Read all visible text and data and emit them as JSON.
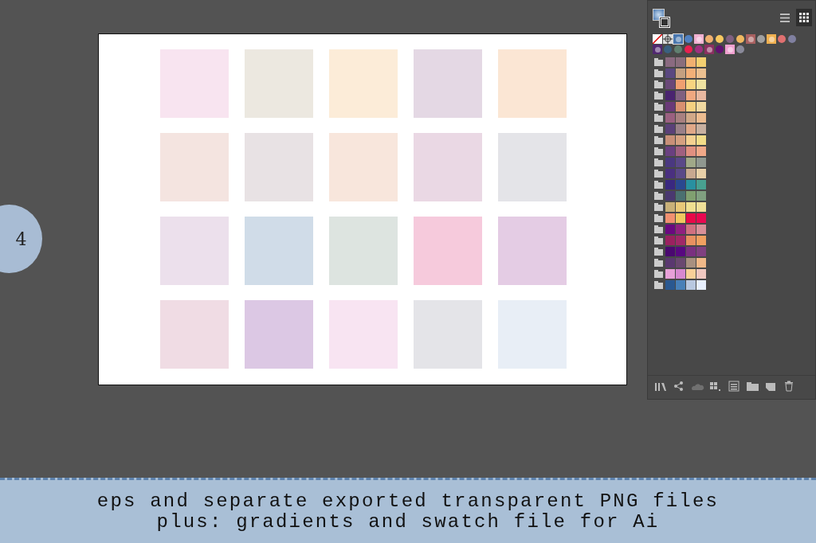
{
  "step_badge": {
    "label": "4"
  },
  "artboard": {
    "tiles": [
      {
        "color": "#f8e4f0"
      },
      {
        "color": "#ece8e0"
      },
      {
        "color": "#fcecd8"
      },
      {
        "color": "#e4d8e4"
      },
      {
        "color": "#fbe6d4"
      },
      {
        "color": "#f4e4e0"
      },
      {
        "color": "#e8e2e4"
      },
      {
        "color": "#f8e6dc"
      },
      {
        "color": "#ead8e4"
      },
      {
        "color": "#e4e4e8"
      },
      {
        "color": "#ece0ec"
      },
      {
        "color": "#d0dce8"
      },
      {
        "color": "#dde4e0"
      },
      {
        "color": "#f6cadc"
      },
      {
        "color": "#e4cce4"
      },
      {
        "color": "#f0dce4"
      },
      {
        "color": "#dcc8e4"
      },
      {
        "color": "#f8e4f2"
      },
      {
        "color": "#e4e4e8"
      },
      {
        "color": "#e8eef6"
      }
    ]
  },
  "swatches_panel": {
    "views": [
      {
        "kind": "list",
        "selected": false
      },
      {
        "kind": "grid",
        "selected": true
      }
    ],
    "gradient_swatches": [
      {
        "kind": "none",
        "selected": false
      },
      {
        "kind": "registration",
        "selected": false
      },
      {
        "kind": "square",
        "color": "#4a78b0",
        "selected": true
      },
      {
        "kind": "circle",
        "color": "#5080c0",
        "selected": false
      },
      {
        "kind": "square",
        "color": "#f0b0d0",
        "selected": false
      },
      {
        "kind": "circle",
        "color": "#f0b070",
        "selected": false
      },
      {
        "kind": "circle",
        "color": "#f8c860",
        "selected": false
      },
      {
        "kind": "circle",
        "color": "#806080",
        "selected": false
      },
      {
        "kind": "circle",
        "color": "#f0b860",
        "selected": false
      },
      {
        "kind": "square",
        "color": "#a86060",
        "selected": false
      },
      {
        "kind": "circle",
        "color": "#a0a0a0",
        "selected": false
      },
      {
        "kind": "square",
        "color": "#f0b050",
        "selected": false
      },
      {
        "kind": "circle",
        "color": "#e07070",
        "selected": false
      },
      {
        "kind": "circle",
        "color": "#8080a0",
        "selected": false
      },
      {
        "kind": "square",
        "color": "#502870",
        "selected": false
      },
      {
        "kind": "circle",
        "color": "#3a6080",
        "selected": false
      },
      {
        "kind": "circle",
        "color": "#608070",
        "selected": false
      },
      {
        "kind": "circle",
        "color": "#e82050",
        "selected": false
      },
      {
        "kind": "circle",
        "color": "#a03080",
        "selected": false
      },
      {
        "kind": "square",
        "color": "#8a3060",
        "selected": false
      },
      {
        "kind": "circle",
        "color": "#601070",
        "selected": false
      },
      {
        "kind": "square",
        "color": "#f0a0d0",
        "selected": false
      },
      {
        "kind": "circle",
        "color": "#8a8a9a",
        "selected": false
      }
    ],
    "color_groups": [
      {
        "colors": [
          {
            "color": "#8a6a80"
          },
          {
            "color": "#8a6e7c"
          },
          {
            "color": "#f0b070"
          },
          {
            "color": "#f3cf70"
          }
        ]
      },
      {
        "colors": [
          {
            "color": "#5a4880"
          },
          {
            "color": "#c4a080"
          },
          {
            "color": "#f2b078"
          },
          {
            "color": "#ecc090"
          }
        ]
      },
      {
        "colors": [
          {
            "color": "#6a4878"
          },
          {
            "color": "#f0a070"
          },
          {
            "color": "#f7d480"
          },
          {
            "color": "#efe2a0"
          }
        ]
      },
      {
        "colors": [
          {
            "color": "#4a2470"
          },
          {
            "color": "#806080"
          },
          {
            "color": "#f0a880"
          },
          {
            "color": "#e8b8a0"
          }
        ]
      },
      {
        "colors": [
          {
            "color": "#6a3a78"
          },
          {
            "color": "#d89070"
          },
          {
            "color": "#f5d080"
          },
          {
            "color": "#f0d8a0"
          }
        ]
      },
      {
        "colors": [
          {
            "color": "#9a6080"
          },
          {
            "color": "#a88080"
          },
          {
            "color": "#d0a888"
          },
          {
            "color": "#ecbc90"
          }
        ]
      },
      {
        "colors": [
          {
            "color": "#5a4078"
          },
          {
            "color": "#9a8088"
          },
          {
            "color": "#e0a888"
          },
          {
            "color": "#c8b0a0"
          }
        ]
      },
      {
        "colors": [
          {
            "color": "#c89078"
          },
          {
            "color": "#d4a080"
          },
          {
            "color": "#f4d090"
          },
          {
            "color": "#f2dc88"
          }
        ]
      },
      {
        "colors": [
          {
            "color": "#6a4080"
          },
          {
            "color": "#a06080"
          },
          {
            "color": "#e09080"
          },
          {
            "color": "#f0a888"
          }
        ]
      },
      {
        "colors": [
          {
            "color": "#4a3880"
          },
          {
            "color": "#5a4888"
          },
          {
            "color": "#a0a888"
          },
          {
            "color": "#909890"
          }
        ]
      },
      {
        "colors": [
          {
            "color": "#4a3080"
          },
          {
            "color": "#5a4888"
          },
          {
            "color": "#c8a890"
          },
          {
            "color": "#e8d0a8"
          }
        ]
      },
      {
        "colors": [
          {
            "color": "#3a2880"
          },
          {
            "color": "#2a4890"
          },
          {
            "color": "#2890a0"
          },
          {
            "color": "#48a090"
          }
        ]
      },
      {
        "colors": [
          {
            "color": "#4a3870"
          },
          {
            "color": "#4a7070"
          },
          {
            "color": "#80a070"
          },
          {
            "color": "#80a080"
          }
        ]
      },
      {
        "colors": [
          {
            "color": "#c8b078"
          },
          {
            "color": "#e8c878"
          },
          {
            "color": "#f0e090"
          },
          {
            "color": "#f0e098"
          }
        ]
      },
      {
        "colors": [
          {
            "color": "#f09070"
          },
          {
            "color": "#f0c860"
          },
          {
            "color": "#e80848"
          },
          {
            "color": "#e80850"
          }
        ]
      },
      {
        "colors": [
          {
            "color": "#6a0880"
          },
          {
            "color": "#902080"
          },
          {
            "color": "#d07080"
          },
          {
            "color": "#d89098"
          }
        ]
      },
      {
        "colors": [
          {
            "color": "#9a2060"
          },
          {
            "color": "#a02868"
          },
          {
            "color": "#e89060"
          },
          {
            "color": "#f0a060"
          }
        ]
      },
      {
        "colors": [
          {
            "color": "#4a0870"
          },
          {
            "color": "#580880"
          },
          {
            "color": "#7a3080"
          },
          {
            "color": "#804080"
          }
        ]
      },
      {
        "colors": [
          {
            "color": "#5a3870"
          },
          {
            "color": "#6a4870"
          },
          {
            "color": "#a89080"
          },
          {
            "color": "#f0b888"
          }
        ]
      },
      {
        "colors": [
          {
            "color": "#e8a0d8"
          },
          {
            "color": "#d888d0"
          },
          {
            "color": "#f8d098"
          },
          {
            "color": "#f0c8c0"
          }
        ]
      },
      {
        "colors": [
          {
            "color": "#2a5890"
          },
          {
            "color": "#4880b8"
          },
          {
            "color": "#b8c8e0"
          },
          {
            "color": "#e8f0ff"
          }
        ]
      }
    ],
    "footer_tools": [
      {
        "kind": "library",
        "disabled": false
      },
      {
        "kind": "share",
        "disabled": false
      },
      {
        "kind": "cloud",
        "disabled": true
      },
      {
        "kind": "kinds",
        "disabled": false
      },
      {
        "kind": "options",
        "disabled": false
      },
      {
        "kind": "folder",
        "disabled": false
      },
      {
        "kind": "new",
        "disabled": false
      },
      {
        "kind": "trash",
        "disabled": false
      }
    ]
  },
  "caption": {
    "lines": [
      "eps and separate exported transparent PNG files",
      "plus: gradients and swatch file for Ai"
    ]
  }
}
